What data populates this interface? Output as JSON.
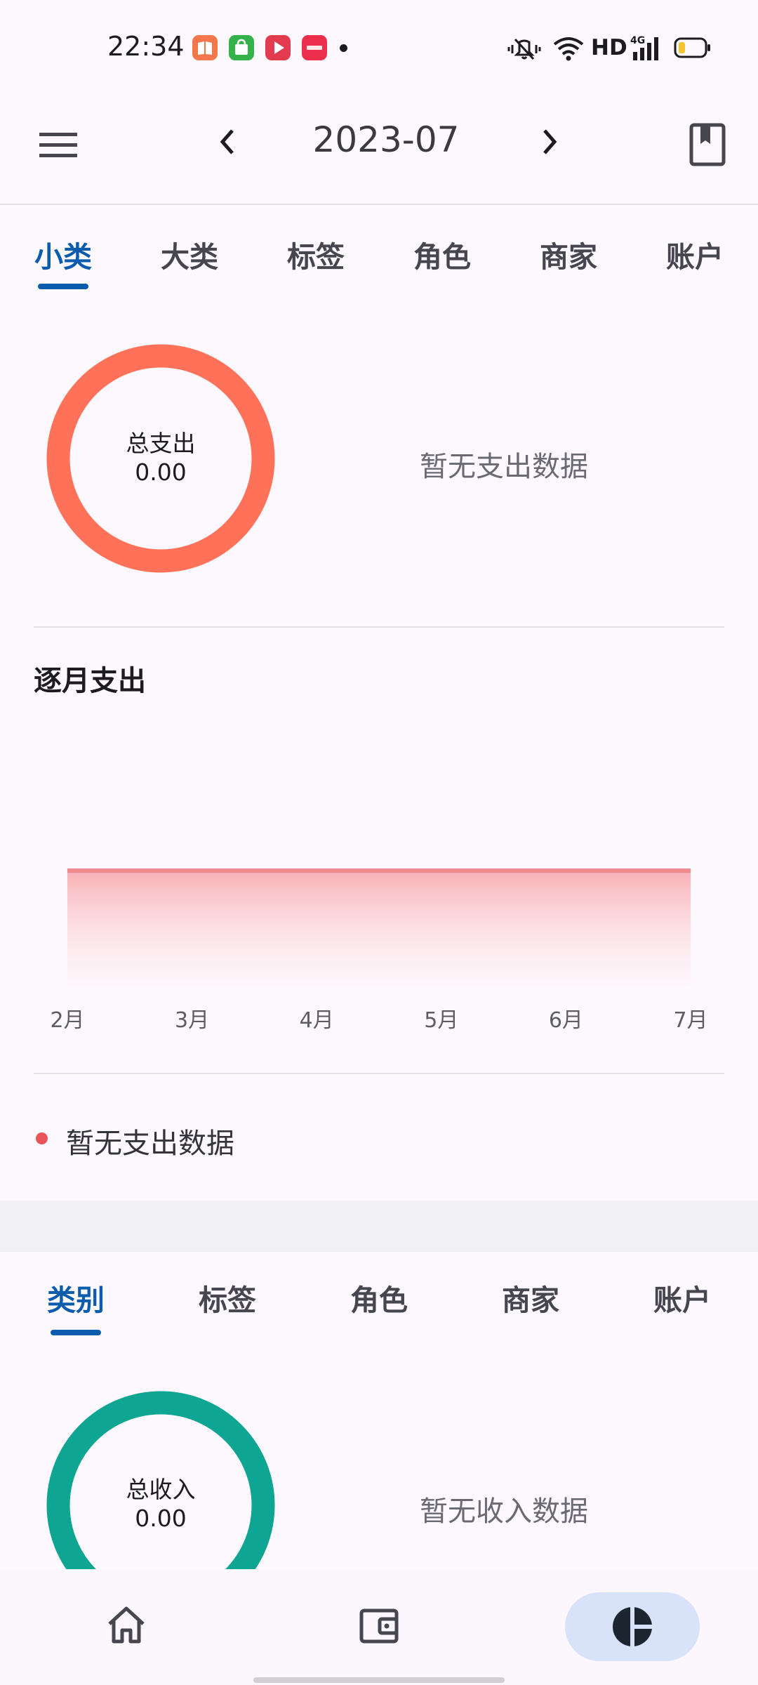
{
  "status_bar": {
    "time": "22:34",
    "network": "HD",
    "icons": [
      "book-app-icon",
      "shop-app-icon",
      "video-app-icon",
      "xiaohongshu-app-icon",
      "mute-icon",
      "wifi-icon",
      "signal-4g-icon",
      "battery-low-icon"
    ]
  },
  "top_bar": {
    "month": "2023-07",
    "icons": [
      "menu-icon",
      "chevron-left-icon",
      "chevron-right-icon",
      "book-icon"
    ]
  },
  "expense": {
    "tabs": [
      "小类",
      "大类",
      "标签",
      "角色",
      "商家",
      "账户"
    ],
    "active_tab": 0,
    "donut_title": "总支出",
    "donut_value": "0.00",
    "donut_color": "#ff7158",
    "empty_text": "暂无支出数据",
    "monthly_title": "逐月支出",
    "legend_text": "暂无支出数据",
    "legend_color": "#e8545a"
  },
  "chart_data": {
    "type": "area",
    "categories": [
      "2月",
      "3月",
      "4月",
      "5月",
      "6月",
      "7月"
    ],
    "values": [
      0,
      0,
      0,
      0,
      0,
      0
    ],
    "title": "逐月支出",
    "xlabel": "",
    "ylabel": "",
    "grid": false,
    "color": "#f08a8e"
  },
  "income": {
    "tabs": [
      "类别",
      "标签",
      "角色",
      "商家",
      "账户"
    ],
    "active_tab": 0,
    "donut_title": "总收入",
    "donut_value": "0.00",
    "donut_color": "#0ea593",
    "empty_text": "暂无收入数据"
  },
  "bottom_nav": {
    "items": [
      "home-icon",
      "wallet-icon",
      "pie-chart-icon"
    ],
    "active": 2,
    "accent": "#d8e2f8"
  }
}
